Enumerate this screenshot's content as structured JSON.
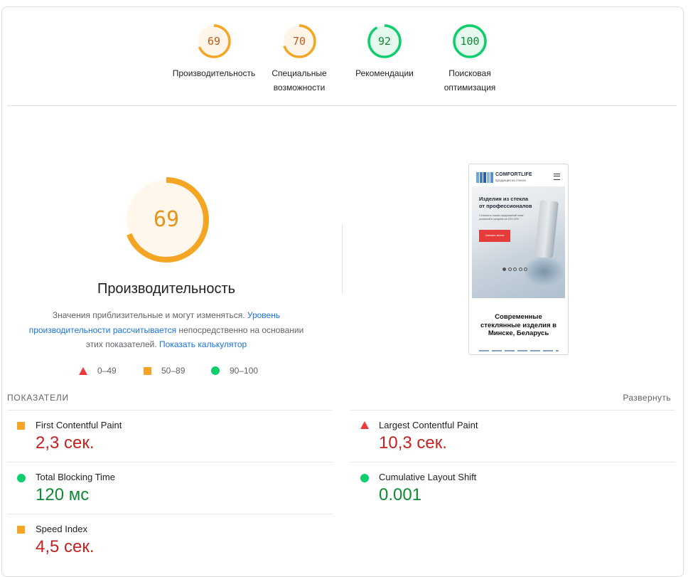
{
  "colors": {
    "average": "#f5a524",
    "average_text": "#c5591a",
    "good": "#0cce6b",
    "good_text": "#0d8a34",
    "poor": "#eb3b3b",
    "link": "#1a73e8"
  },
  "summary": [
    {
      "score": 69,
      "label": "Производительность",
      "rating": "average"
    },
    {
      "score": 70,
      "label": "Специальные возможности",
      "rating": "average"
    },
    {
      "score": 92,
      "label": "Рекомендации",
      "rating": "good"
    },
    {
      "score": 100,
      "label": "Поисковая оптимизация",
      "rating": "good"
    }
  ],
  "main_score": {
    "score": "69",
    "title": "Производительность",
    "desc_text_1": "Значения приблизительные и могут изменяться. ",
    "desc_link_1": "Уровень производительности рассчитывается",
    "desc_text_2": " непосредственно на основании этих показателей. ",
    "desc_link_2": "Показать калькулятор"
  },
  "legend": [
    {
      "shape": "triangle",
      "range": "0–49"
    },
    {
      "shape": "square",
      "range": "50–89"
    },
    {
      "shape": "circle",
      "range": "90–100"
    }
  ],
  "screenshot": {
    "brand": "COMFORTLIFE",
    "brand_sub": "продукция из стекла",
    "hero_title_1": "Изделия из стекла",
    "hero_title_2": "от профессионалов",
    "hero_text": "Стоимость наших предложений ниже рыночной в среднем на 15%-20%",
    "hero_button": "Заказать звонок",
    "heading_1": "Современные",
    "heading_2": "стеклянные изделия в",
    "heading_3": "Минске, Беларусь"
  },
  "metrics": {
    "title": "ПОКАЗАТЕЛИ",
    "expand_label": "Развернуть",
    "items": [
      {
        "label": "First Contentful Paint",
        "value": "2,3 сек.",
        "rating": "average"
      },
      {
        "label": "Largest Contentful Paint",
        "value": "10,3 сек.",
        "rating": "poor"
      },
      {
        "label": "Total Blocking Time",
        "value": "120 мс",
        "rating": "good"
      },
      {
        "label": "Cumulative Layout Shift",
        "value": "0.001",
        "rating": "good"
      },
      {
        "label": "Speed Index",
        "value": "4,5 сек.",
        "rating": "average"
      }
    ]
  }
}
